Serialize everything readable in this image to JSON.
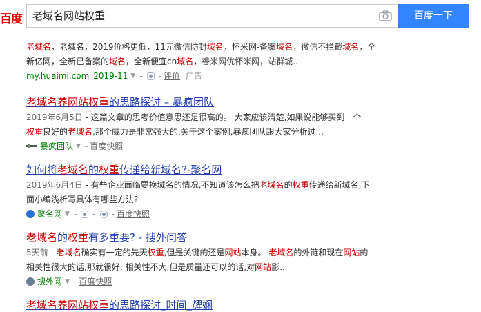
{
  "header": {
    "logo_text": "百度",
    "search_value": "老域名网站权重",
    "search_button": "百度一下",
    "camera_icon": "camera-icon"
  },
  "ad_result": {
    "abstract_line1": [
      "老域名",
      "，老域名，2019价格更低，11元微信防封",
      "域名",
      "，怀米网-备案",
      "域名",
      "，微信不拦截",
      "域名",
      "，全"
    ],
    "abstract_line2": [
      "新亿网，全新已备案的",
      "域名",
      "，全新便宜cn",
      "域名",
      "，睿米网优怀米网，站群城.."
    ],
    "url": "my.huaimi.com",
    "date": "2019-11",
    "review": "评价",
    "ad_tag": "广告"
  },
  "results": [
    {
      "title_parts": [
        "老域名养网站权重",
        "的思路探讨 – 暴疯团队"
      ],
      "date": "2019年6月5日",
      "abstract_line1": " - 这篇文章的思考价值意思还是很高的。 大家应该清楚,如果说能够买到一个",
      "abstract_line2_parts": [
        "权重",
        "良好的",
        "老域名",
        ",那个威力是非常强大的,关于这个案例,暴疯团队跟大家分析过..."
      ],
      "source": "暴疯团队",
      "snapshot": "百度快照"
    },
    {
      "title_parts": [
        "如何将",
        "老域名",
        "的",
        "权重",
        "传递给新域名?-聚名网"
      ],
      "date": "2019年6月4日",
      "abstract_line1_parts": [
        " - 有些企业面临要换域名的情况,不知道该怎么把",
        "老域名",
        "的",
        "权重",
        "传递给新域名,下"
      ],
      "abstract_line2": "面小编浅析写具体有哪些方法?",
      "source": "聚名网",
      "snapshot": "百度快照"
    },
    {
      "title_parts": [
        "老域名",
        "的",
        "权重",
        "有多重要? - 搜外问答"
      ],
      "date": "5天前",
      "abstract_line1_parts": [
        " - ",
        "老域名",
        "确实有一定的先天",
        "权重",
        ",但是关键的还是",
        "网站",
        "本身。 ",
        "老域名",
        "的外链和现在",
        "网站",
        "的"
      ],
      "abstract_line2_parts": [
        "相关性很大的话,那就很好, 相关性不大,但是质量还可以的话,对",
        "网站",
        "影..."
      ],
      "source": "搜外网",
      "snapshot": "百度快照"
    },
    {
      "title_parts": [
        "老域名养网站权重",
        "的思路探讨_时间_耀娴"
      ]
    }
  ],
  "colors": {
    "link": "#2440b3",
    "highlight": "#c00000",
    "source_green": "#008000",
    "button_blue": "#3385ff",
    "logo_red": "#e10602"
  }
}
